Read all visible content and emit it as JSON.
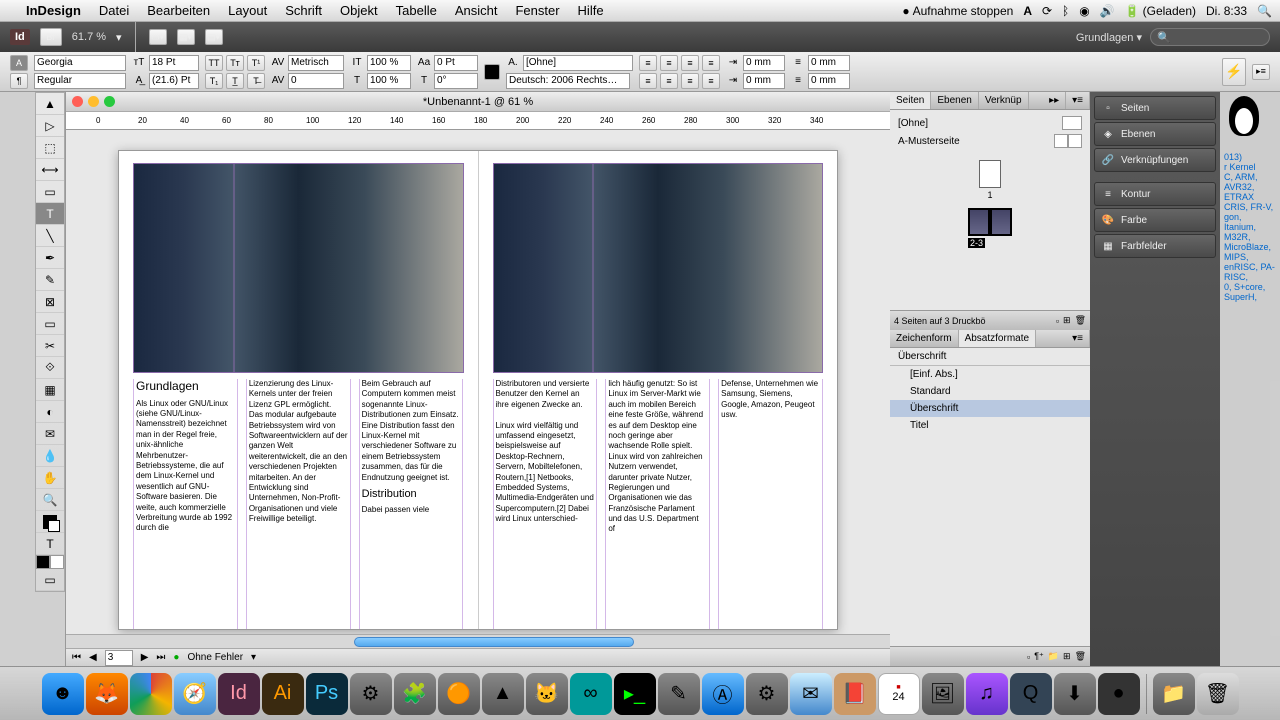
{
  "menubar": {
    "app": "InDesign",
    "items": [
      "Datei",
      "Bearbeiten",
      "Layout",
      "Schrift",
      "Objekt",
      "Tabelle",
      "Ansicht",
      "Fenster",
      "Hilfe"
    ],
    "recording": "Aufnahme stoppen",
    "battery": "(Geladen)",
    "day": "Di.",
    "time": "8:33"
  },
  "appbar": {
    "zoom": "61.7 %",
    "workspace": "Grundlagen"
  },
  "control": {
    "font": "Georgia",
    "style": "Regular",
    "size": "18 Pt",
    "leading": "(21.6) Pt",
    "optical": "Metrisch",
    "tracking": "0",
    "hscale": "100 %",
    "vscale": "100 %",
    "baseline": "0 Pt",
    "charstyle": "[Ohne]",
    "language": "Deutsch: 2006 Rechts…",
    "indent_l": "0 mm",
    "indent_r": "0 mm",
    "space_b": "0 mm",
    "space_a": "0 mm"
  },
  "document": {
    "title": "*Unbenannt-1 @ 61 %",
    "ruler_marks": [
      "0",
      "20",
      "40",
      "60",
      "80",
      "100",
      "120",
      "140",
      "160",
      "180",
      "200",
      "220",
      "240",
      "260",
      "280",
      "300",
      "320",
      "340"
    ],
    "text": {
      "h1": "Grundlagen",
      "c1": "Als Linux oder GNU/Linux (siehe GNU/Linux-Namensstreit) bezeichnet man in der Regel freie, unix-ähnliche Mehrbenutzer-Betriebssysteme, die auf dem Linux-Kernel und wesentlich auf GNU-Software basieren. Die weite, auch kommerzielle Verbreitung wurde ab 1992 durch die",
      "c2": "Lizenzierung des Linux-Kernels unter der freien Lizenz GPL ermöglicht. Das modular aufgebaute Betriebssystem wird von Softwareentwicklern auf der ganzen Welt weiterentwickelt, die an den verschiedenen Projekten mitarbeiten. An der Entwicklung sind Unternehmen, Non-Profit-Organisationen und viele Freiwillige beteiligt.",
      "c3a": "Beim Gebrauch auf Computern kommen meist sogenannte Linux-Distributionen zum Einsatz. Eine Distribution fasst den Linux-Kernel mit verschiedener Software zu einem Betriebssystem zusammen, das für die Endnutzung geeignet ist.",
      "h2": "Distribution",
      "c3b": "Dabei passen viele",
      "c4": "Distributoren und versierte Benutzer den Kernel an ihre eigenen Zwecke an.\n\nLinux wird vielfältig und umfassend eingesetzt, beispielsweise auf Desktop-Rechnern, Servern, Mobiltelefonen, Routern,[1] Netbooks, Embedded Systems, Multimedia-Endgeräten und Supercomputern.[2] Dabei wird Linux unterschied-",
      "c5": "lich häufig genutzt: So ist Linux im Server-Markt wie auch im mobilen Bereich eine feste Größe, während es auf dem Desktop eine noch geringe aber wachsende Rolle spielt. Linux wird von zahlreichen Nutzern verwendet, darunter private Nutzer, Regierungen und Organisationen wie das Französische Parlament und das U.S. Department of",
      "c6": "Defense, Unternehmen wie Samsung, Siemens, Google, Amazon, Peugeot usw."
    }
  },
  "status": {
    "page": "3",
    "preflight": "Ohne Fehler"
  },
  "pages_panel": {
    "tabs": [
      "Seiten",
      "Ebenen",
      "Verknüp"
    ],
    "none": "[Ohne]",
    "master": "A-Musterseite",
    "p1": "1",
    "p23": "2-3",
    "footer": "4 Seiten auf 3 Druckbö"
  },
  "styles_panel": {
    "tabs": [
      "Zeichenform",
      "Absatzformate"
    ],
    "current": "Überschrift",
    "items": [
      "[Einf. Abs.]",
      "Standard",
      "Überschrift",
      "Titel"
    ],
    "selected": "Überschrift"
  },
  "side_panels": [
    "Seiten",
    "Ebenen",
    "Verknüpfungen",
    "Kontur",
    "Farbe",
    "Farbfelder"
  ],
  "desktop_text": {
    "l2": "013)",
    "l3": "r Kernel",
    "l4": "C, ARM, AVR32,",
    "l5": "ETRAX CRIS, FR-V,",
    "l6": "gon, Itanium, M32R,",
    "l7": "MicroBlaze, MIPS,",
    "l8": "enRISC, PA-RISC,",
    "l9": "0, S+core, SuperH,"
  }
}
